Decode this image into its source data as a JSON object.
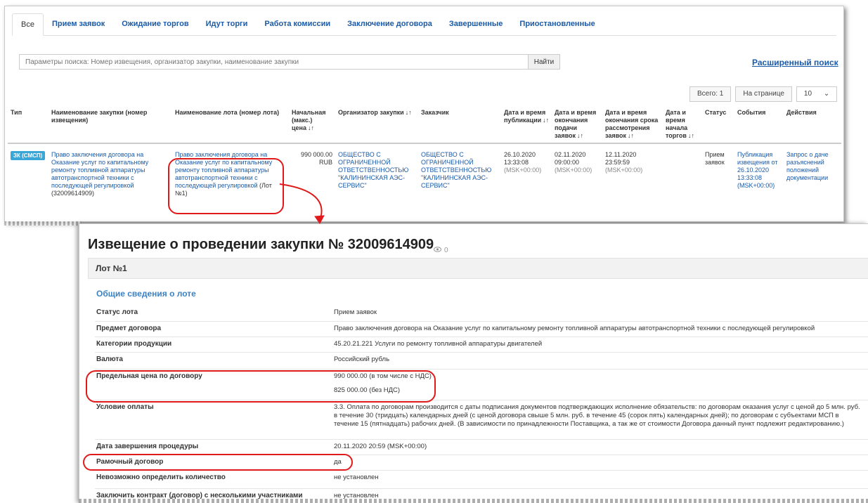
{
  "tabs": [
    {
      "label": "Все"
    },
    {
      "label": "Прием заявок"
    },
    {
      "label": "Ожидание торгов"
    },
    {
      "label": "Идут торги"
    },
    {
      "label": "Работа комиссии"
    },
    {
      "label": "Заключение договора"
    },
    {
      "label": "Завершенные"
    },
    {
      "label": "Приостановленные"
    }
  ],
  "search": {
    "placeholder": "Параметры поиска: Номер извещения, организатор закупки, наименование закупки",
    "button": "Найти",
    "advanced": "Расширенный поиск"
  },
  "pager": {
    "total": "Всего: 1",
    "per_page": "На странице",
    "per_page_value": "10"
  },
  "columns": {
    "type": "Тип",
    "purchase": "Наименование закупки (номер извещения)",
    "lot": "Наименование лота (номер лота)",
    "price": "Начальная (макс.) цена",
    "organizer": "Организатор закупки",
    "customer": "Заказчик",
    "published": "Дата и время публикации",
    "deadline": "Дата и время окончания подачи заявок",
    "review": "Дата и время окончания срока рассмотрения заявок",
    "start": "Дата и время начала торгов",
    "status": "Статус",
    "events": "События",
    "actions": "Действия"
  },
  "row": {
    "type_badge": "ЗК (СМСП)",
    "purchase_link": "Право заключения договора на Оказание услуг по капитальному ремонту топливной аппаратуры автотранспортной техники с последующей регулировкой",
    "purchase_number": "(32009614909)",
    "lot_link": "Право заключения договора на Оказание услуг по капитальному ремонту топливной аппаратуры автотранспортной техники с последующей регулировкой",
    "lot_number": "(Лот №1)",
    "price": "990 000.00",
    "currency": "RUB",
    "organizer": "ОБЩЕСТВО С ОГРАНИЧЕННОЙ ОТВЕТСТВЕННОСТЬЮ \"КАЛИНИНСКАЯ АЭС-СЕРВИС\"",
    "customer": "ОБЩЕСТВО С ОГРАНИЧЕННОЙ ОТВЕТСТВЕННОСТЬЮ \"КАЛИНИНСКАЯ АЭС-СЕРВИС\"",
    "published_date": "26.10.2020",
    "published_time": "13:33:08",
    "published_tz": "(MSK+00:00)",
    "deadline_date": "02.11.2020",
    "deadline_time": "09:00:00",
    "deadline_tz": "(MSK+00:00)",
    "review_date": "12.11.2020",
    "review_time": "23:59:59",
    "review_tz": "(MSK+00:00)",
    "start": "",
    "status": "Прием заявок",
    "event_link": "Публикация извещения от 26.10.2020 13:33:08 (MSK+00:00)",
    "action_link": "Запрос о даче разъяснений положений документации"
  },
  "notice": {
    "title": "Извещение о проведении закупки № 32009614909",
    "views": "0",
    "lot": "Лот №1",
    "section": "Общие сведения о лоте",
    "fields": [
      {
        "label": "Статус лота",
        "value": "Прием заявок"
      },
      {
        "label": "Предмет договора",
        "value": "Право заключения договора на Оказание услуг по капитальному ремонту топливной аппаратуры автотранспортной техники с последующей регулировкой"
      },
      {
        "label": "Категории продукции",
        "value": "45.20.21.221 Услуги по ремонту топливной аппаратуры двигателей"
      },
      {
        "label": "Валюта",
        "value": "Российский рубль"
      },
      {
        "label": "Предельная цена по договору",
        "value": "990 000.00 (в том числе с НДС)",
        "value2": "825 000.00 (без НДС)"
      },
      {
        "label": "Условие оплаты",
        "value": "3.3. Оплата по договорам производится с даты подписания документов подтверждающих исполнение обязательств: по договорам оказания услуг с ценой до 5 млн. руб. в течение 30 (тридцать) календарных дней (с ценой договора свыше 5 млн. руб. в течение 45 (сорок пять) календарных дней); по договорам с субъектами МСП в течение 15 (пятнадцать) рабочих дней. (В зависимости по принадлежности Поставщика, а так же от стоимости Договора данный пункт подлежит редактированию.)"
      },
      {
        "label": "Дата завершения процедуры",
        "value": "20.11.2020 20:59 (MSK+00:00)"
      },
      {
        "label": "Рамочный договор",
        "value": "да"
      },
      {
        "label": "Невозможно определить количество",
        "value": "не установлен"
      },
      {
        "label": "Заключить контракт (договор) с несколькими участниками",
        "value": "не установлен"
      }
    ]
  },
  "colors": {
    "link": "#1a5aa8",
    "badge": "#3aa6d8",
    "annotation": "#e01a1a",
    "section": "#3b82c4"
  }
}
